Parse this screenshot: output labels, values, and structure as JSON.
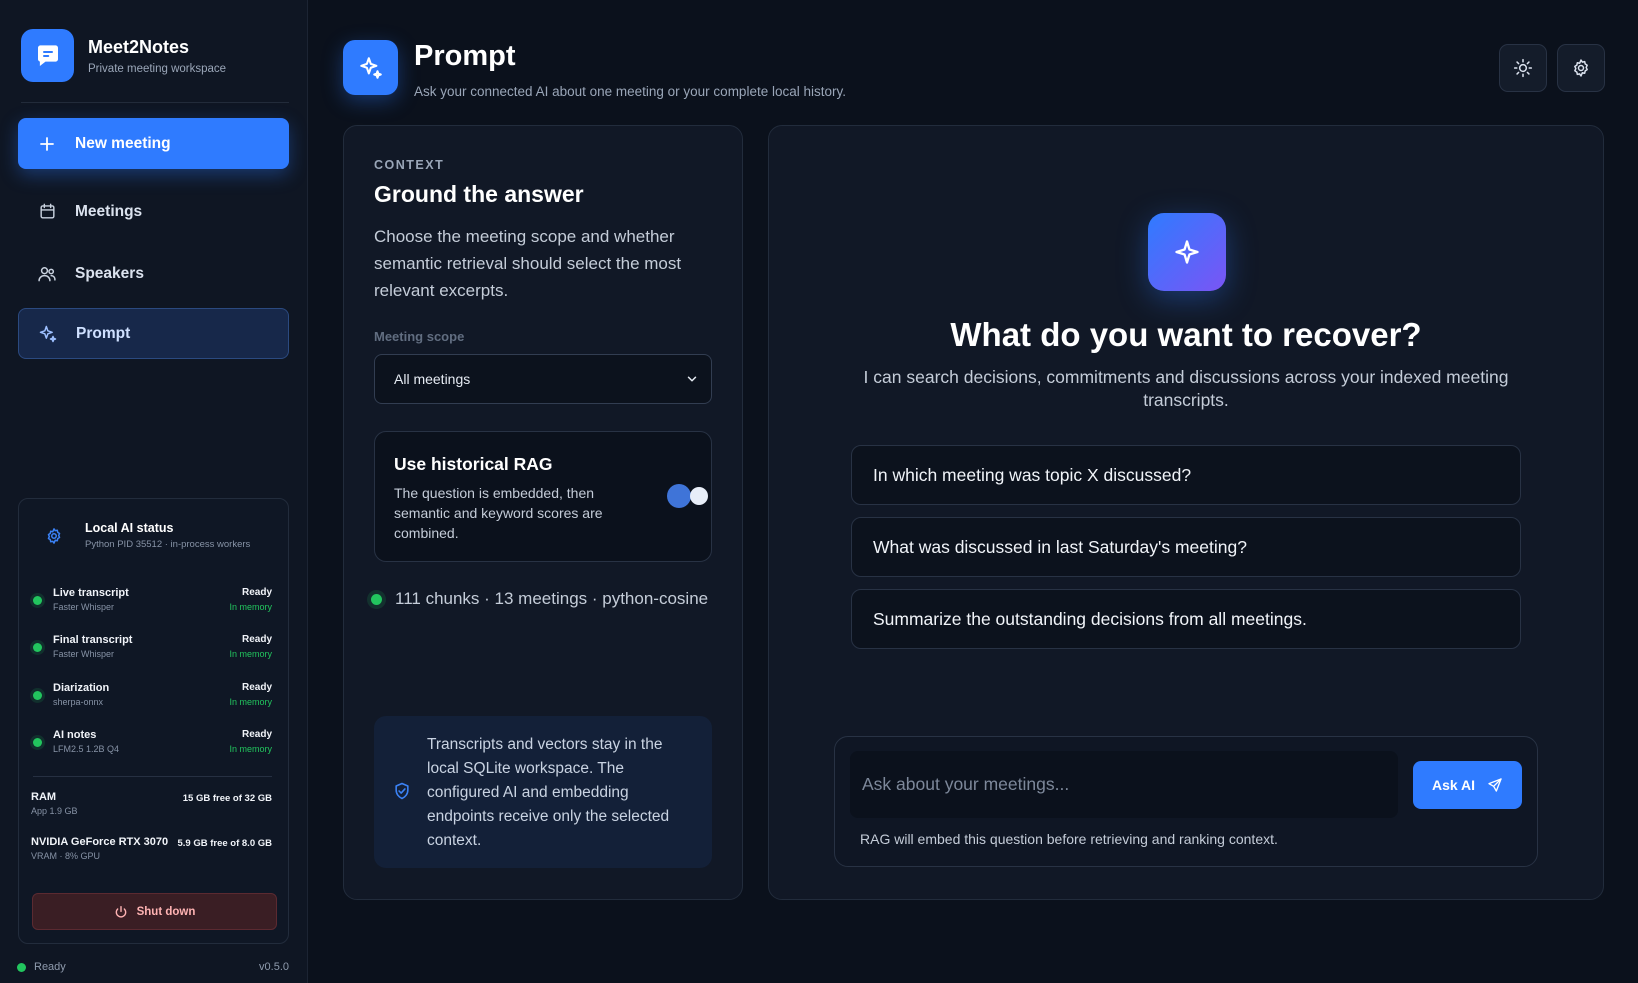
{
  "app": {
    "name": "Meet2Notes",
    "subtitle": "Private meeting workspace",
    "version": "v0.5.0",
    "footer_status": "Ready"
  },
  "colors": {
    "accent": "#2f7bff",
    "ready": "#22c55e",
    "danger_bg": "#3a1e24"
  },
  "sidebar": {
    "items": [
      {
        "label": "New meeting",
        "icon": "plus-icon"
      },
      {
        "label": "Meetings",
        "icon": "calendar-icon"
      },
      {
        "label": "Speakers",
        "icon": "users-icon"
      },
      {
        "label": "Prompt",
        "icon": "sparkle-icon",
        "active": true
      }
    ]
  },
  "ai_status": {
    "title": "Local AI status",
    "subtitle": "Python PID 35512 · in-process workers",
    "services": [
      {
        "name": "Live transcript",
        "engine": "Faster Whisper",
        "state": "Ready",
        "location": "In memory"
      },
      {
        "name": "Final transcript",
        "engine": "Faster Whisper",
        "state": "Ready",
        "location": "In memory"
      },
      {
        "name": "Diarization",
        "engine": "sherpa-onnx",
        "state": "Ready",
        "location": "In memory"
      },
      {
        "name": "AI notes",
        "engine": "LFM2.5 1.2B Q4",
        "state": "Ready",
        "location": "In memory"
      }
    ],
    "resources": [
      {
        "name": "RAM",
        "detail": "App 1.9 GB",
        "value": "15 GB free of 32 GB"
      },
      {
        "name": "NVIDIA GeForce RTX 3070",
        "detail": "VRAM · 8% GPU",
        "value": "5.9 GB free of 8.0 GB"
      }
    ],
    "shutdown_label": "Shut down"
  },
  "header": {
    "title": "Prompt",
    "subtitle": "Ask your connected AI about one meeting or your complete local history."
  },
  "context": {
    "eyebrow": "CONTEXT",
    "title": "Ground the answer",
    "description": "Choose the meeting scope and whether semantic retrieval should select the most relevant excerpts.",
    "scope_label": "Meeting scope",
    "scope_value": "All meetings",
    "rag_title": "Use historical RAG",
    "rag_description": "The question is embedded, then semantic and keyword scores are combined.",
    "rag_enabled": true,
    "index_info": "111 chunks · 13 meetings · python-cosine",
    "privacy_note": "Transcripts and vectors stay in the local SQLite workspace. The configured AI and embedding endpoints receive only the selected context."
  },
  "chat": {
    "hero_title": "What do you want to recover?",
    "hero_subtitle": "I can search decisions, commitments and discussions across your indexed meeting transcripts.",
    "suggestions": [
      "In which meeting was topic X discussed?",
      "What was discussed in last Saturday's meeting?",
      "Summarize the outstanding decisions from all meetings."
    ],
    "input_placeholder": "Ask about your meetings...",
    "ask_label": "Ask AI",
    "hint": "RAG will embed this question before retrieving and ranking context."
  }
}
